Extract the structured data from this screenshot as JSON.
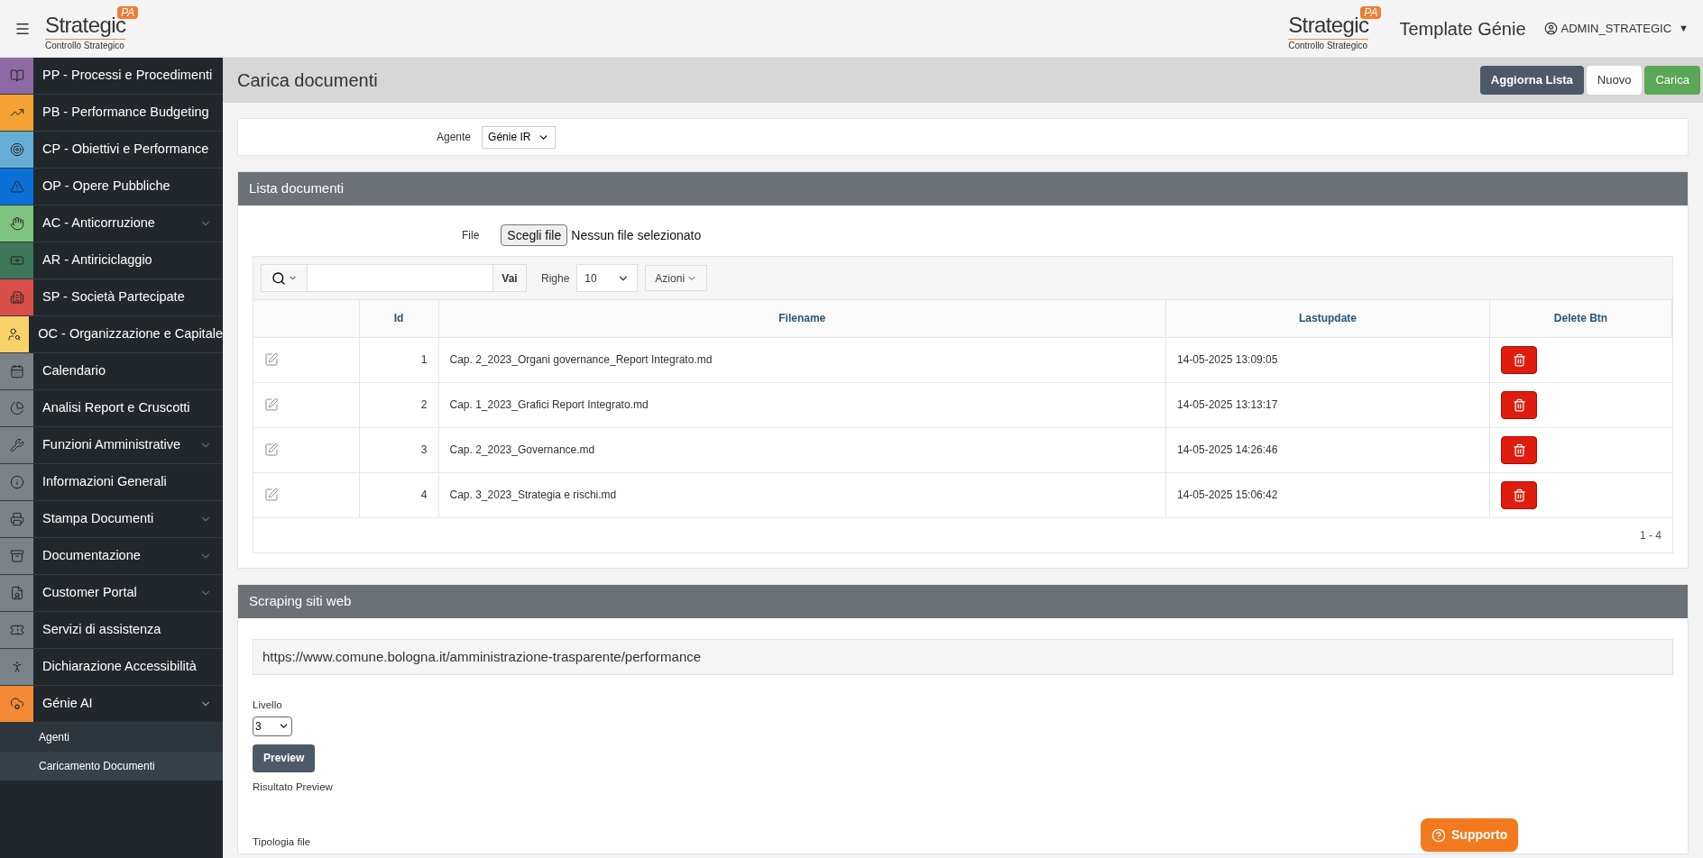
{
  "header": {
    "logos": [
      {
        "word": "Strategic",
        "badge": "PA",
        "tagline": "Controllo Strategico"
      },
      {
        "word": "Strategic",
        "badge": "PA",
        "tagline": "Controllo Strategico"
      }
    ],
    "app_title": "Template Génie",
    "user": {
      "name": "ADMIN_STRATEGIC",
      "caret": "▼"
    }
  },
  "sidebar": {
    "items": [
      {
        "label": "PP - Processi e Procedimenti",
        "color": "#8f6aa6",
        "expandable": false
      },
      {
        "label": "PB - Performance Budgeting",
        "color": "#f3a233",
        "expandable": false
      },
      {
        "label": "CP - Obiettivi e Performance",
        "color": "#66aed6",
        "expandable": false
      },
      {
        "label": "OP - Opere Pubbliche",
        "color": "#0b6fd8",
        "expandable": false
      },
      {
        "label": "AC - Anticorruzione",
        "color": "#7ec27f",
        "expandable": true,
        "expanded": false
      },
      {
        "label": "AR - Antiriciclaggio",
        "color": "#3e7659",
        "expandable": false
      },
      {
        "label": "SP - Società Partecipate",
        "color": "#d9504a",
        "expandable": false
      },
      {
        "label": "OC - Organizzazione e Capitale",
        "color": "#f7d36a",
        "expandable": false
      },
      {
        "label": "Calendario",
        "color": "#7b8288",
        "expandable": false
      },
      {
        "label": "Analisi Report e Cruscotti",
        "color": "#7b8288",
        "expandable": false
      },
      {
        "label": "Funzioni Amministrative",
        "color": "#7b8288",
        "expandable": true,
        "expanded": false
      },
      {
        "label": "Informazioni Generali",
        "color": "#7b8288",
        "expandable": false
      },
      {
        "label": "Stampa Documenti",
        "color": "#7b8288",
        "expandable": true,
        "expanded": false
      },
      {
        "label": "Documentazione",
        "color": "#7b8288",
        "expandable": true,
        "expanded": false
      },
      {
        "label": "Customer Portal",
        "color": "#7b8288",
        "expandable": true,
        "expanded": false
      },
      {
        "label": "Servizi di assistenza",
        "color": "#7b8288",
        "expandable": false
      },
      {
        "label": "Dichiarazione Accessibilità",
        "color": "#7b8288",
        "expandable": false
      },
      {
        "label": "Génie AI",
        "color": "#f28a35",
        "expandable": true,
        "expanded": true,
        "children": [
          {
            "label": "Agenti",
            "selected": false
          },
          {
            "label": "Caricamento Documenti",
            "selected": true
          }
        ]
      }
    ]
  },
  "page": {
    "title": "Carica documenti",
    "buttons": [
      {
        "label": "Aggiorna Lista",
        "kind": "dark"
      },
      {
        "label": "Nuovo",
        "kind": "plain"
      },
      {
        "label": "Carica",
        "kind": "success"
      }
    ]
  },
  "agent_field": {
    "label": "Agente",
    "value": "Génie IR"
  },
  "documents": {
    "title": "Lista documenti",
    "file_label": "File",
    "file_button": "Scegli file",
    "file_status": "Nessun file selezionato",
    "toolbar": {
      "go_button": "Vai",
      "rows_label": "Righe",
      "rows_value": "10",
      "actions_button": "Azioni"
    },
    "table": {
      "columns": [
        "Id",
        "Filename",
        "Lastupdate",
        "Delete Btn"
      ],
      "rows": [
        {
          "id": "1",
          "filename": "Cap. 2_2023_Organi governance_Report Integrato.md",
          "lastupdate": "14-05-2025 13:09:05"
        },
        {
          "id": "2",
          "filename": "Cap. 1_2023_Grafici Report Integrato.md",
          "lastupdate": "14-05-2025 13:13:17"
        },
        {
          "id": "3",
          "filename": "Cap. 2_2023_Governance.md",
          "lastupdate": "14-05-2025 14:26:46"
        },
        {
          "id": "4",
          "filename": "Cap. 3_2023_Strategia e rischi.md",
          "lastupdate": "14-05-2025 15:06:42"
        }
      ]
    },
    "pagination": "1 - 4"
  },
  "scraping": {
    "title": "Scraping siti web",
    "url": "https://www.comune.bologna.it/amministrazione-trasparente/performance",
    "level_label": "Livello",
    "level_value": "3",
    "preview_button": "Preview",
    "result_label": "Risultato Preview",
    "file_type_label": "Tipologia file"
  },
  "support_button": "Supporto"
}
